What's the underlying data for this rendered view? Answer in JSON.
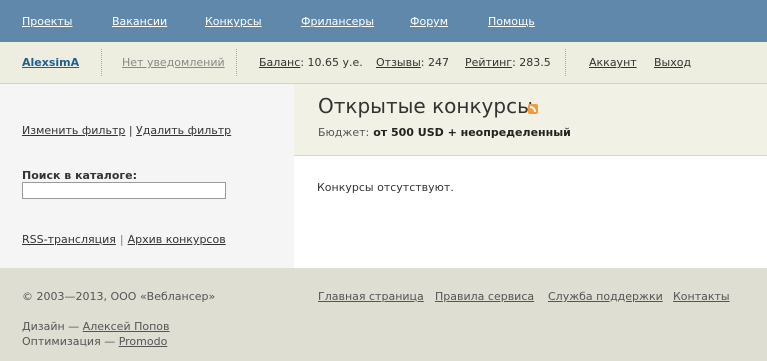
{
  "nav": {
    "items": [
      "Проекты",
      "Вакансии",
      "Конкурсы",
      "Фрилансеры",
      "Форум",
      "Помощь"
    ]
  },
  "userbar": {
    "username": "AlexsimA",
    "notifications": "Нет уведомлений",
    "balance_label": "Баланс",
    "balance_value": ": 10.65 у.е.",
    "reviews_label": "Отзывы",
    "reviews_value": ": 247",
    "rating_label": "Рейтинг",
    "rating_value": ": 283.5",
    "account": "Аккаунт",
    "logout": "Выход"
  },
  "sidebar": {
    "change_filter": "Изменить фильтр",
    "filter_sep": " | ",
    "delete_filter": "Удалить фильтр",
    "search_label": "Поиск в каталоге:",
    "search_value": "",
    "rss_link": "RSS-трансляция",
    "rss_sep": "|",
    "archive_link": "Архив конкурсов"
  },
  "content": {
    "title": "Открытые конкурсы",
    "budget_label": "Бюджет:",
    "budget_value": "от 500 USD + неопределенный",
    "empty_message": "Конкурсы отсутствуют."
  },
  "footer": {
    "copyright": "© 2003—2013, ООО «Веблансер»",
    "links": [
      "Главная страница",
      "Правила сервиса",
      "Служба поддержки",
      "Контакты"
    ],
    "design_label": "Дизайн — ",
    "design_author": "Алексей Попов",
    "optimization_label": "Оптимизация — ",
    "optimization_author": "Promodo"
  },
  "colors": {
    "nav_bg": "#5f88aa",
    "userbar_bg": "#eeeee0",
    "header_bg": "#f1f1e6",
    "footer_bg": "#deded3",
    "username": "#1f5f95"
  }
}
